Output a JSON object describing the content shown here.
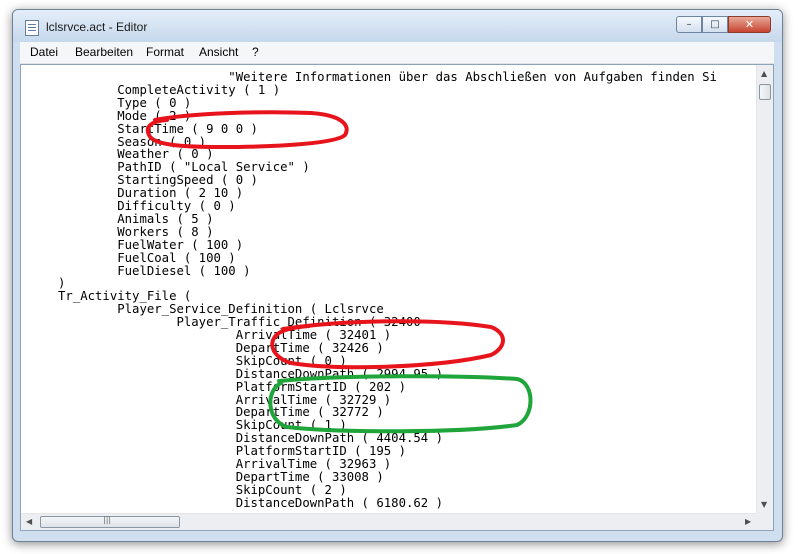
{
  "window": {
    "title": "lclsrvce.act - Editor",
    "icon": "notepad-icon",
    "controls": {
      "minimize": "–",
      "maximize": "□",
      "close": "✕"
    }
  },
  "menu": [
    "Datei",
    "Bearbeiten",
    "Format",
    "Ansicht",
    "?"
  ],
  "lines": [
    "                            \"Weitere Informationen über das Abschließen von Aufgaben finden Si",
    "             CompleteActivity ( 1 )",
    "             Type ( 0 )",
    "             Mode ( 2 )",
    "             StartTime ( 9 0 0 )",
    "             Season ( 0 )",
    "             Weather ( 0 )",
    "             PathID ( \"Local Service\" )",
    "             StartingSpeed ( 0 )",
    "             Duration ( 2 10 )",
    "             Difficulty ( 0 )",
    "             Animals ( 5 )",
    "             Workers ( 8 )",
    "             FuelWater ( 100 )",
    "             FuelCoal ( 100 )",
    "             FuelDiesel ( 100 )",
    "     )",
    "     Tr_Activity_File (",
    "             Player_Service_Definition ( Lclsrvce",
    "                     Player_Traffic_Definition ( 32400",
    "                             ArrivalTime ( 32401 )",
    "                             DepartTime ( 32426 )",
    "                             SkipCount ( 0 )",
    "                             DistanceDownPath ( 2994.95 )",
    "                             PlatformStartID ( 202 )",
    "                             ArrivalTime ( 32729 )",
    "                             DepartTime ( 32772 )",
    "                             SkipCount ( 1 )",
    "                             DistanceDownPath ( 4404.54 )",
    "                             PlatformStartID ( 195 )",
    "                             ArrivalTime ( 32963 )",
    "                             DepartTime ( 33008 )",
    "                             SkipCount ( 2 )",
    "                             DistanceDownPath ( 6180.62 )"
  ],
  "annotations": {
    "red": "#e8141c",
    "green": "#1fa53a"
  },
  "scrollbar": {
    "up": "▲",
    "down": "▼",
    "left": "◀",
    "right": "▶",
    "grip": "|||"
  }
}
